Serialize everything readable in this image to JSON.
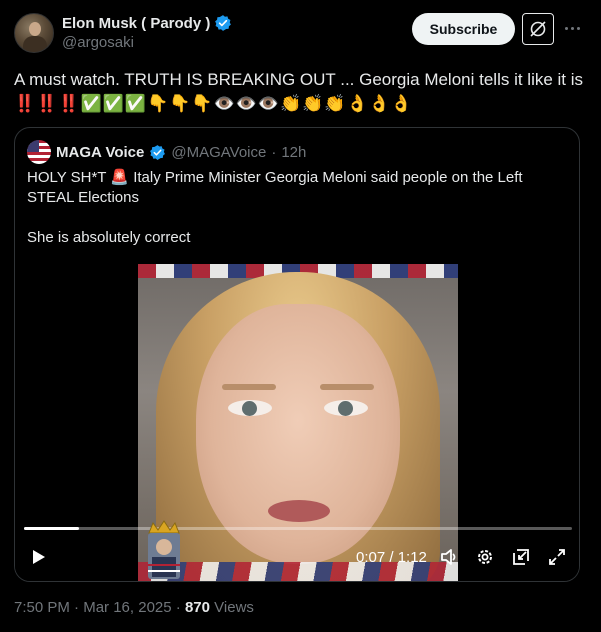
{
  "author": {
    "display_name": "Elon Musk ( Parody )",
    "handle": "@argosaki"
  },
  "actions": {
    "subscribe_label": "Subscribe"
  },
  "tweet": {
    "text_main": "A must watch. TRUTH IS BREAKING OUT ... Georgia Meloni tells it like it is",
    "emojis": "‼️‼️‼️✅✅✅👇👇👇👁️👁️👁️👏👏👏👌👌👌"
  },
  "quote": {
    "display_name": "MAGA Voice",
    "handle": "@MAGAVoice",
    "separator": "·",
    "time": "12h",
    "line1": "HOLY SH*T 🚨 Italy Prime Minister Georgia Meloni said people on the Left STEAL Elections",
    "line2": "She is absolutely correct"
  },
  "video": {
    "time_display": "0:07 / 1:12",
    "progress": 0.1
  },
  "footer": {
    "time": "7:50 PM",
    "sep1": "·",
    "date": "Mar 16, 2025",
    "sep2": "·",
    "views_count": "870",
    "views_label": "Views"
  },
  "colors": {
    "background": "#000000",
    "text": "#e7e9ea",
    "muted": "#71767b",
    "verified": "#1d9bf0",
    "border": "#2f3336"
  }
}
